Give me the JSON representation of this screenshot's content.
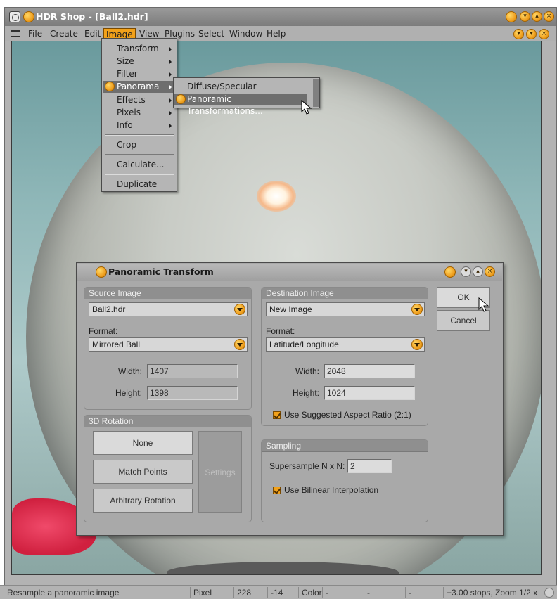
{
  "window": {
    "title": "HDR Shop - [Ball2.hdr]",
    "title_controls": [
      "▾",
      "▴",
      "×"
    ],
    "doc_controls": [
      "▾",
      "▾",
      "×"
    ]
  },
  "menubar": {
    "items": [
      "File",
      "Create",
      "Edit",
      "Image",
      "View",
      "Plugins",
      "Select",
      "Window",
      "Help"
    ],
    "active": "Image"
  },
  "image_menu": {
    "items": [
      "Transform",
      "Size",
      "Filter",
      "Panorama",
      "Effects",
      "Pixels",
      "Info",
      "Crop",
      "Calculate...",
      "Duplicate"
    ],
    "selected": "Panorama"
  },
  "panorama_submenu": {
    "items": [
      "Diffuse/Specular Convolution...",
      "Panoramic Transformations..."
    ],
    "selected": "Panoramic Transformations..."
  },
  "dialog": {
    "title": "Panoramic Transform",
    "controls": [
      "▾",
      "▴",
      "×"
    ],
    "source": {
      "header": "Source Image",
      "image": "Ball2.hdr",
      "format_label": "Format:",
      "format": "Mirrored Ball",
      "width_label": "Width:",
      "width": "1407",
      "height_label": "Height:",
      "height": "1398"
    },
    "destination": {
      "header": "Destination Image",
      "image": "New Image",
      "format_label": "Format:",
      "format": "Latitude/Longitude",
      "width_label": "Width:",
      "width": "2048",
      "height_label": "Height:",
      "height": "1024",
      "aspect_label": "Use Suggested Aspect Ratio (2:1)"
    },
    "rotation": {
      "header": "3D Rotation",
      "none": "None",
      "match_points": "Match Points",
      "arbitrary": "Arbitrary Rotation",
      "settings": "Settings"
    },
    "sampling": {
      "header": "Sampling",
      "supersample_label": "Supersample N x N:",
      "supersample": "2",
      "bilinear_label": "Use Bilinear Interpolation"
    },
    "ok": "OK",
    "cancel": "Cancel"
  },
  "status": {
    "message": "Resample a panoramic image",
    "pixel_label": "Pixel",
    "x": "228",
    "y": "-14",
    "color_label": "Color",
    "c1": "-",
    "c2": "-",
    "c3": "-",
    "zoom": "+3.00 stops, Zoom 1/2 x"
  }
}
